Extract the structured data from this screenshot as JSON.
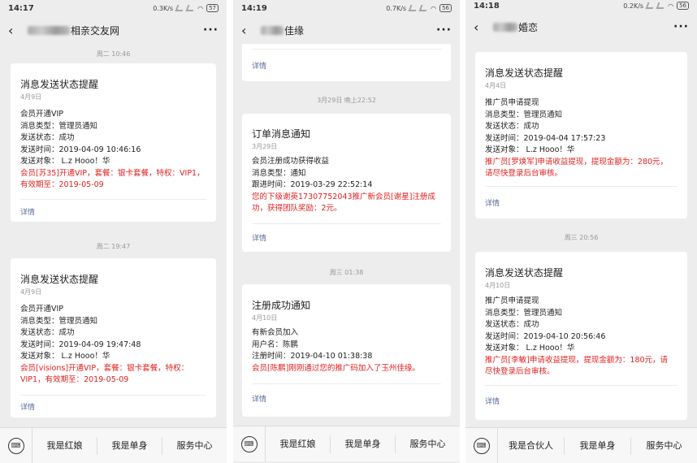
{
  "phones": [
    {
      "status": {
        "time": "14:17",
        "speed": "0.3K/s",
        "battery": "57"
      },
      "nav": {
        "title": "相亲交友网"
      },
      "stamps": [
        "周二 10:46",
        "周二 19:47"
      ],
      "cards": [
        {
          "title": "消息发送状态提醒",
          "date": "4月9日",
          "lines": [
            "会员开通VIP",
            "消息类型：管理员通知",
            "发送状态：成功",
            "发送时间：2019-04-09 10:46:16",
            "发送对象： L.z Hooo！华"
          ],
          "red": [
            "会员[苏35]开通VIP，套餐：银卡套餐，特权：VIP1，",
            "有效期至：2019-05-09"
          ],
          "detail": "详情"
        },
        {
          "title": "消息发送状态提醒",
          "date": "4月9日",
          "lines": [
            "会员开通VIP",
            "消息类型：管理员通知",
            "发送状态：成功",
            "发送时间：2019-04-09 19:47:48",
            "发送对象： L.z Hooo！华"
          ],
          "red": [
            "会员[visions]开通VIP，套餐：银卡套餐，特权：",
            "VIP1，有效期至：2019-05-09"
          ],
          "detail": "详情"
        }
      ],
      "menu": [
        "我是红娘",
        "我是单身",
        "服务中心"
      ]
    },
    {
      "status": {
        "time": "14:19",
        "speed": "0.7K/s",
        "battery": "56"
      },
      "nav": {
        "title": "佳缘"
      },
      "stamps": [
        "3月29日 晚上22:52",
        "周三 01:38"
      ],
      "top_detail": "详情",
      "cards": [
        {
          "title": "订单消息通知",
          "date": "3月29日",
          "lines": [
            "会员注册成功获得收益",
            "消息类型：通知",
            "跟进时间：2019-03-29 22:52:14"
          ],
          "red": [
            "您的下级谢英17307752043推广新会员[谢星]注册成",
            "功，获得团队奖励：2元。"
          ],
          "detail": "详情"
        },
        {
          "title": "注册成功通知",
          "date": "4月10日",
          "lines": [
            "有新会员加入",
            "用户名：陈鹏",
            "注册时间：2019-04-10 01:38:38"
          ],
          "red": [
            "会员[陈鹏]刚刚通过您的推广码加入了玉州佳缘。"
          ],
          "detail": "详情"
        }
      ],
      "menu": [
        "我是红娘",
        "我是单身",
        "服务中心"
      ]
    },
    {
      "status": {
        "time": "14:18",
        "speed": "0.2K/s",
        "battery": "56"
      },
      "nav": {
        "title": "婚恋"
      },
      "stamps": [
        "周三 20:56"
      ],
      "cards": [
        {
          "title": "消息发送状态提醒",
          "date": "4月4日",
          "lines": [
            "推广员申请提现",
            "消息类型：管理员通知",
            "发送状态：成功",
            "发送时间：2019-04-04 17:57:23",
            "发送对象： L.z Hooo！华"
          ],
          "red": [
            "推广员[罗焕军]申请收益提现，提现金额为：280元，",
            "请尽快登录后台审核。"
          ],
          "detail": "详情"
        },
        {
          "title": "消息发送状态提醒",
          "date": "4月10日",
          "lines": [
            "推广员申请提现",
            "消息类型：管理员通知",
            "发送状态：成功",
            "发送时间：2019-04-10 20:56:46",
            "发送对象： L.z Hooo！华"
          ],
          "red": [
            "推广员[李敏]申请收益提现，提现金额为：180元，请",
            "尽快登录后台审核。"
          ],
          "detail": "详情"
        }
      ],
      "menu": [
        "我是合伙人",
        "我是单身",
        "服务中心"
      ]
    }
  ]
}
